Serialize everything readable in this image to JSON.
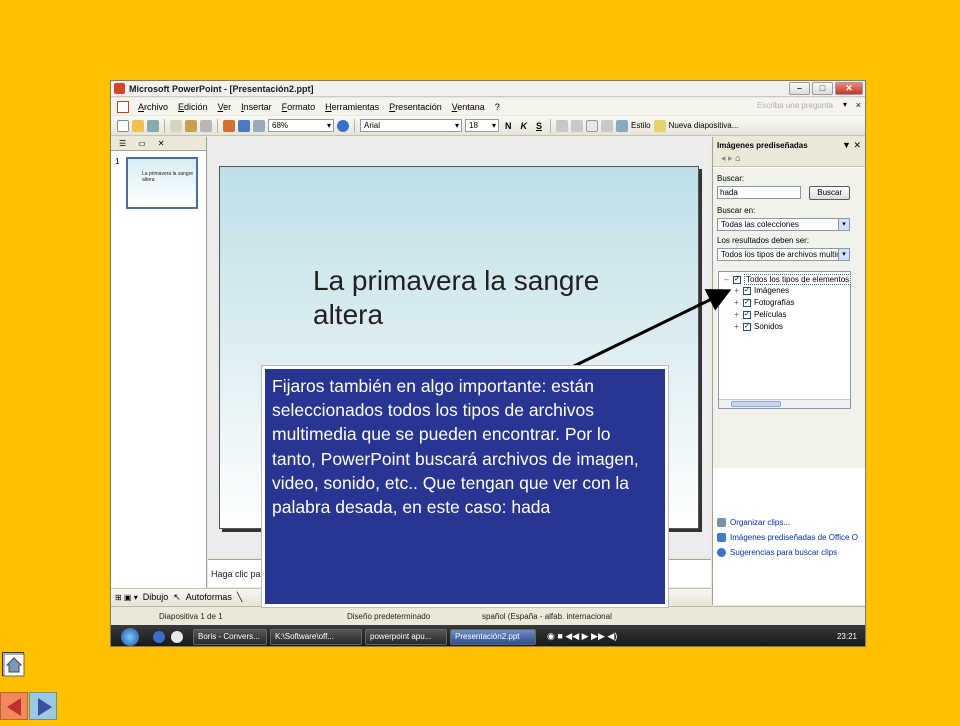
{
  "window": {
    "title": "Microsoft PowerPoint - [Presentación2.ppt]",
    "minimize": "–",
    "maximize": "□",
    "close": "✕"
  },
  "menu": {
    "items": [
      "Archivo",
      "Edición",
      "Ver",
      "Insertar",
      "Formato",
      "Herramientas",
      "Presentación",
      "Ventana",
      "?"
    ],
    "help_placeholder": "Escriba una pregunta",
    "close_doc": "×"
  },
  "toolbar": {
    "zoom": "68%",
    "font": "Arial",
    "size": "18",
    "bold": "N",
    "italic": "K",
    "underline": "S",
    "style_label": "Estilo",
    "new_slide_label": "Nueva diapositiva..."
  },
  "left_panel": {
    "close": "✕",
    "slide_number": "1",
    "thumb_text": "La primavera la sangre altera"
  },
  "slide": {
    "title": "La primavera la sangre altera"
  },
  "notes": {
    "placeholder": "Haga clic par"
  },
  "drawbar": {
    "dibujo": "Dibujo",
    "autoformas": "Autoformas"
  },
  "status": {
    "slide": "Diapositiva 1 de 1",
    "design": "Diseño predeterminado",
    "language": "spañol (España - alfab. internacional"
  },
  "taskpane": {
    "title": "Imágenes prediseñadas",
    "search_label": "Buscar:",
    "search_value": "hada",
    "search_button": "Buscar",
    "search_in_label": "Buscar en:",
    "search_in_value": "Todas las colecciones",
    "results_label": "Los resultados deben ser:",
    "results_value": "Todos los tipos de archivos multir",
    "tree": {
      "root": "Todos los tipos de elementos",
      "items": [
        "Imágenes",
        "Fotografías",
        "Películas",
        "Sonidos"
      ]
    },
    "links": [
      "Organizar clips...",
      "Imágenes prediseñadas de Office O",
      "Sugerencias para buscar clips"
    ]
  },
  "taskbar": {
    "items": [
      "Boris - Convers...",
      "K:\\Software\\off...",
      "powerpoint apu...",
      "Presentación2.ppt"
    ],
    "clock": "23:21"
  },
  "callout": {
    "text": "Fijaros también en algo importante: están seleccionados todos los tipos de archivos multimedia que se pueden encontrar. Por lo tanto, PowerPoint buscará archivos de imagen, video, sonido, etc.. Que tengan que ver con la palabra desada, en este caso: hada"
  },
  "colors": {
    "background": "#ffc000",
    "callout_bg": "#283593",
    "slide_gradient_top": "#bfdfe6",
    "arrow": "#000000"
  }
}
